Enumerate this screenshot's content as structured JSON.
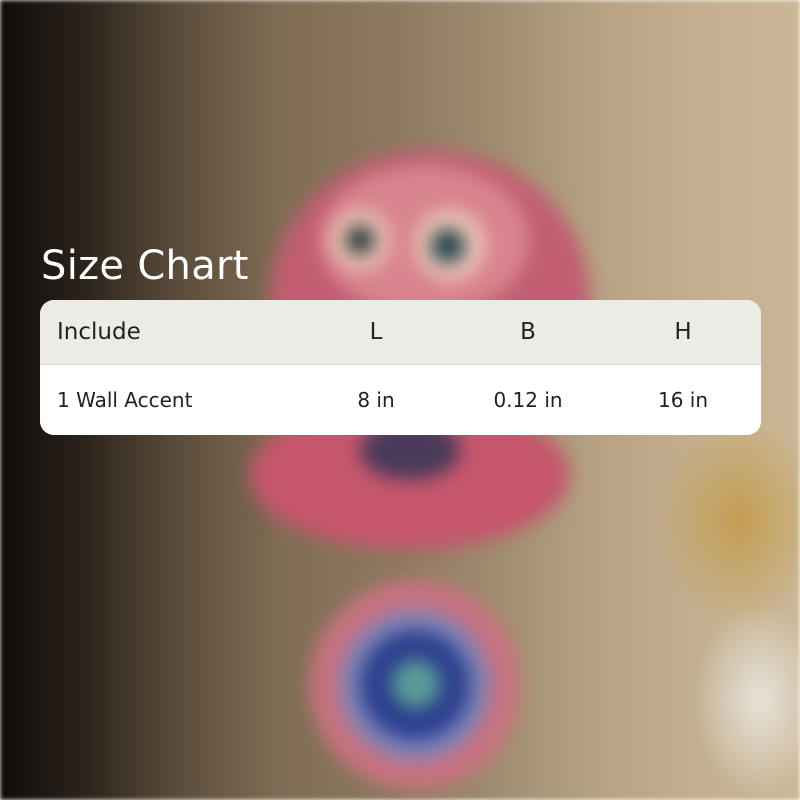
{
  "title": "Size Chart",
  "table": {
    "headers": [
      "Include",
      "L",
      "B",
      "H"
    ],
    "rows": [
      [
        "1 Wall Accent",
        "8 in",
        "0.12 in",
        "16 in"
      ]
    ]
  }
}
